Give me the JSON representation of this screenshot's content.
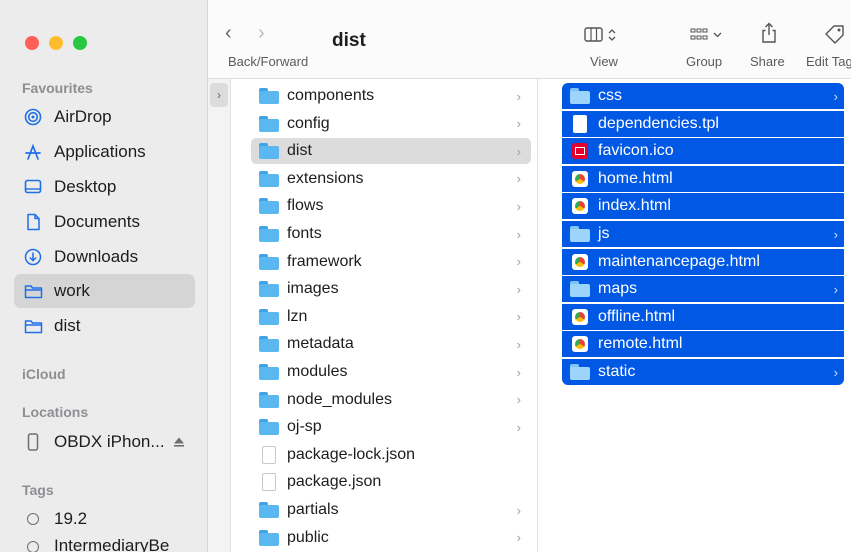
{
  "window": {
    "title": "dist"
  },
  "toolbar": {
    "back_forward_label": "Back/Forward",
    "view_label": "View",
    "group_label": "Group",
    "share_label": "Share",
    "edit_tags_label": "Edit Tag"
  },
  "sidebar": {
    "favourites_heading": "Favourites",
    "favourites": [
      {
        "label": "AirDrop",
        "icon": "airdrop-icon"
      },
      {
        "label": "Applications",
        "icon": "applications-icon"
      },
      {
        "label": "Desktop",
        "icon": "desktop-icon"
      },
      {
        "label": "Documents",
        "icon": "document-icon"
      },
      {
        "label": "Downloads",
        "icon": "download-icon"
      },
      {
        "label": "work",
        "icon": "folder-icon",
        "active": true
      },
      {
        "label": "dist",
        "icon": "folder-icon"
      }
    ],
    "icloud_heading": "iCloud",
    "locations_heading": "Locations",
    "locations": [
      {
        "label": "OBDX iPhon...",
        "icon": "phone-icon",
        "eject": "eject-icon"
      }
    ],
    "tags_heading": "Tags",
    "tags": [
      {
        "label": "19.2"
      },
      {
        "label": "IntermediaryBe"
      }
    ]
  },
  "columns": {
    "col2": [
      {
        "name": "components",
        "type": "folder",
        "chevron": true
      },
      {
        "name": "config",
        "type": "folder",
        "chevron": true
      },
      {
        "name": "dist",
        "type": "folder",
        "chevron": true,
        "selected": true
      },
      {
        "name": "extensions",
        "type": "folder",
        "chevron": true
      },
      {
        "name": "flows",
        "type": "folder",
        "chevron": true
      },
      {
        "name": "fonts",
        "type": "folder",
        "chevron": true
      },
      {
        "name": "framework",
        "type": "folder",
        "chevron": true
      },
      {
        "name": "images",
        "type": "folder",
        "chevron": true
      },
      {
        "name": "lzn",
        "type": "folder",
        "chevron": true
      },
      {
        "name": "metadata",
        "type": "folder",
        "chevron": true
      },
      {
        "name": "modules",
        "type": "folder",
        "chevron": true
      },
      {
        "name": "node_modules",
        "type": "folder",
        "chevron": true
      },
      {
        "name": "oj-sp",
        "type": "folder",
        "chevron": true
      },
      {
        "name": "package-lock.json",
        "type": "doc",
        "chevron": false
      },
      {
        "name": "package.json",
        "type": "doc",
        "chevron": false
      },
      {
        "name": "partials",
        "type": "folder",
        "chevron": true
      },
      {
        "name": "public",
        "type": "folder",
        "chevron": true
      }
    ],
    "col3": [
      {
        "name": "css",
        "type": "folder",
        "chevron": true
      },
      {
        "name": "dependencies.tpl",
        "type": "doc",
        "chevron": false
      },
      {
        "name": "favicon.ico",
        "type": "favicon",
        "chevron": false
      },
      {
        "name": "home.html",
        "type": "chrome",
        "chevron": false
      },
      {
        "name": "index.html",
        "type": "chrome",
        "chevron": false
      },
      {
        "name": "js",
        "type": "folder",
        "chevron": true
      },
      {
        "name": "maintenancepage.html",
        "type": "chrome",
        "chevron": false
      },
      {
        "name": "maps",
        "type": "folder",
        "chevron": true
      },
      {
        "name": "offline.html",
        "type": "chrome",
        "chevron": false
      },
      {
        "name": "remote.html",
        "type": "chrome",
        "chevron": false
      },
      {
        "name": "static",
        "type": "folder",
        "chevron": true
      }
    ]
  },
  "colors": {
    "selection": "#0058e5",
    "sidebar_bg": "#ececec",
    "folder": "#5ab7f0"
  }
}
